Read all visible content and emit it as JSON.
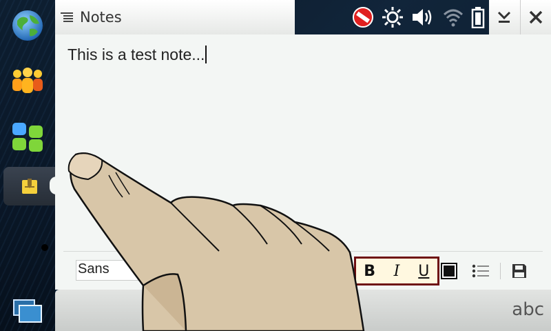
{
  "app": {
    "title": "Notes"
  },
  "note": {
    "text": "This is a test note..."
  },
  "format_toolbar": {
    "font": "Sans",
    "bold_label": "B",
    "italic_label": "I",
    "underline_label": "U"
  },
  "bottom_bar": {
    "input_mode": "abc"
  },
  "sidebar": {
    "items": [
      {
        "name": "web-browser",
        "icon": "globe-icon"
      },
      {
        "name": "contacts",
        "icon": "people-icon"
      },
      {
        "name": "applications",
        "icon": "app-grid-icon"
      },
      {
        "name": "notes",
        "icon": "notes-icon",
        "active": true
      }
    ]
  },
  "status_icons": [
    "no-entry-icon",
    "brightness-icon",
    "volume-icon",
    "wifi-icon",
    "battery-icon"
  ],
  "colors": {
    "background_dark": "#0d1e30",
    "content_bg": "#f3f6f4",
    "style_group_border": "#6e0f12",
    "style_group_bg": "#fff8e0"
  }
}
